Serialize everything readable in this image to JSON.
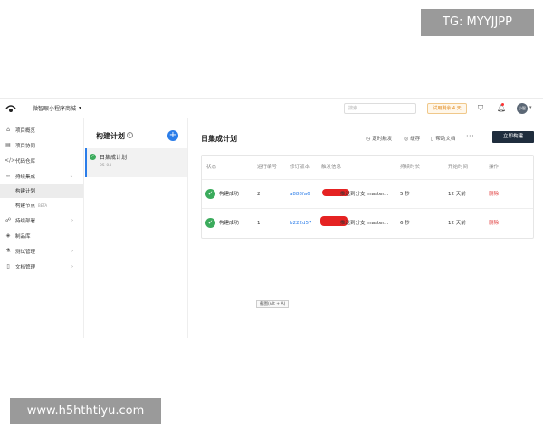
{
  "watermarks": {
    "telegram": "TG: MYYJJPP",
    "site": "www.h5hthtiyu.com"
  },
  "header": {
    "project_name": "微智眼小程序商城",
    "search_placeholder": "搜索",
    "trial_label": "试用剩余 4 天",
    "avatar_text": "小智"
  },
  "sidebar": {
    "items": [
      {
        "icon": "home-icon",
        "label": "项目概览"
      },
      {
        "icon": "team-icon",
        "label": "项目协同"
      },
      {
        "icon": "code-icon",
        "label": "代码仓库"
      },
      {
        "icon": "infinity-icon",
        "label": "持续集成"
      }
    ],
    "ci_sub": [
      {
        "label": "构建计划",
        "active": true
      },
      {
        "label": "构建节点",
        "badge": "BETA"
      }
    ],
    "items_after": [
      {
        "icon": "deploy-icon",
        "label": "持续部署"
      },
      {
        "icon": "package-icon",
        "label": "制品库"
      },
      {
        "icon": "test-icon",
        "label": "测试管理"
      },
      {
        "icon": "doc-icon",
        "label": "文档管理"
      }
    ]
  },
  "midpanel": {
    "title": "构建计划",
    "plan": {
      "name": "日集成计划",
      "date": "05-04"
    }
  },
  "main": {
    "title": "日集成计划",
    "actions": {
      "timer": "定时触发",
      "cache": "缓存",
      "help": "帮助文档",
      "build": "立即构建"
    },
    "columns": [
      "状态",
      "运行编号",
      "修订版本",
      "触发信息",
      "持续时长",
      "开始时间",
      "操作"
    ],
    "rows": [
      {
        "status": "构建成功",
        "run": "2",
        "commit": "a888fa6",
        "trigger": "推送到分支 master...",
        "duration": "5 秒",
        "start": "12 天前",
        "op": "删除"
      },
      {
        "status": "构建成功",
        "run": "1",
        "commit": "b222d57",
        "trigger": "推送到分支 master...",
        "duration": "6 秒",
        "start": "12 天前",
        "op": "删除"
      }
    ]
  },
  "tooltip": "截图(Alt + A)",
  "colors": {
    "accent": "#2b7de9",
    "success": "#3bab5c",
    "danger": "#e03b3b",
    "build_button": "#1f2d3d"
  }
}
